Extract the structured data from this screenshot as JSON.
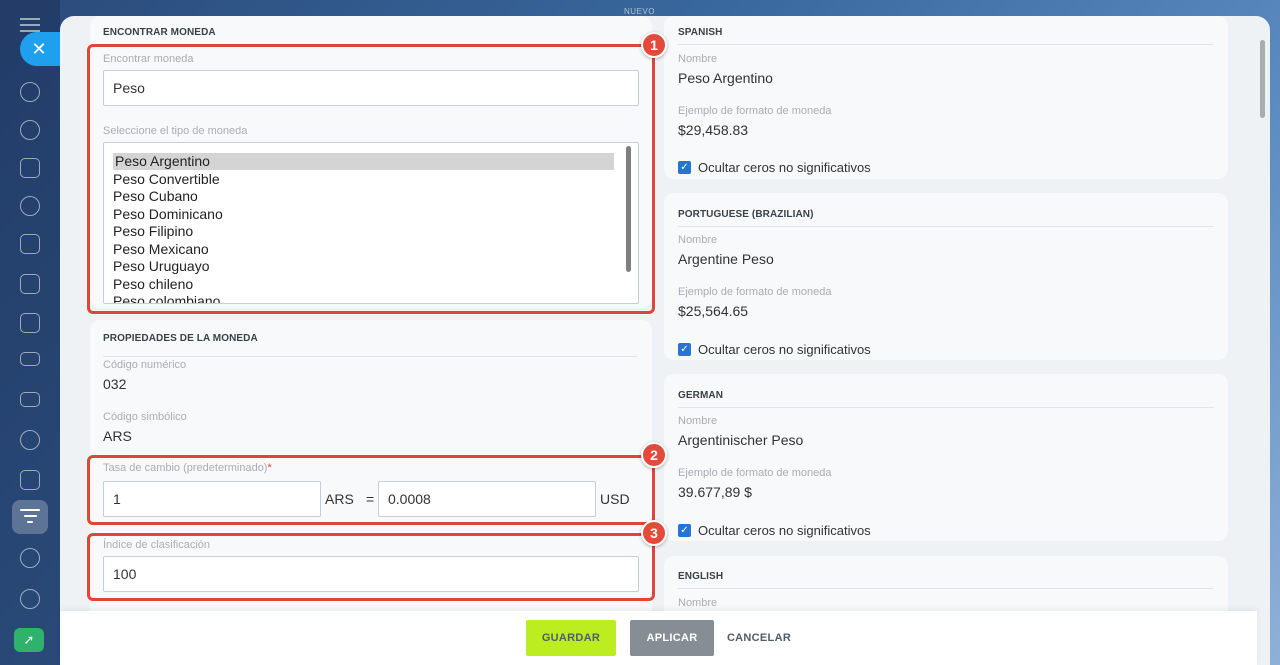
{
  "header": {
    "nuevo": "NUEVO"
  },
  "sidebar": {
    "close_symbol": "✕",
    "icons": [
      "menu-icon",
      "close-icon",
      "pulse-icon",
      "chat-icon",
      "tasks-icon",
      "crm-icon",
      "calendar-icon",
      "docs-icon",
      "whiteboard-icon",
      "billing-icon",
      "mail-icon",
      "contacts-icon",
      "checklist-icon",
      "filter-icon",
      "robot-icon",
      "settings-icon",
      "rocket-icon"
    ],
    "rocket_symbol": "➚"
  },
  "find": {
    "title": "ENCONTRAR MONEDA",
    "search_label": "Encontrar moneda",
    "search_value": "Peso",
    "type_label": "Seleccione el tipo de moneda",
    "options": [
      "Peso Argentino",
      "Peso Convertible",
      "Peso Cubano",
      "Peso Dominicano",
      "Peso Filipino",
      "Peso Mexicano",
      "Peso Uruguayo",
      "Peso chileno",
      "Peso colombiano"
    ],
    "selected": "Peso Argentino"
  },
  "props": {
    "title": "PROPIEDADES DE LA MONEDA",
    "numeric_label": "Código numérico",
    "numeric_value": "032",
    "symbolic_label": "Código simbólico",
    "symbolic_value": "ARS",
    "rate_label": "Tasa de cambio (predeterminado)",
    "rate_required": "*",
    "rate_amount": "1",
    "rate_from": "ARS",
    "rate_eq": "=",
    "rate_value": "0.0008",
    "rate_to": "USD",
    "sort_label": "Índice de clasificación",
    "sort_value": "100"
  },
  "badges": [
    "1",
    "2",
    "3"
  ],
  "languages": [
    {
      "title": "SPANISH",
      "name_label": "Nombre",
      "name": "Peso Argentino",
      "format_label": "Ejemplo de formato de moneda",
      "format": "$29,458.83",
      "hide_zeros": "Ocultar ceros no significativos"
    },
    {
      "title": "PORTUGUESE (BRAZILIAN)",
      "name_label": "Nombre",
      "name": "Argentine Peso",
      "format_label": "Ejemplo de formato de moneda",
      "format": "$25,564.65",
      "hide_zeros": "Ocultar ceros no significativos"
    },
    {
      "title": "GERMAN",
      "name_label": "Nombre",
      "name": "Argentinischer Peso",
      "format_label": "Ejemplo de formato de moneda",
      "format": "39.677,89 $",
      "hide_zeros": "Ocultar ceros no significativos"
    },
    {
      "title": "ENGLISH",
      "name_label": "Nombre"
    }
  ],
  "check_symbol": "✓",
  "footer": {
    "save": "GUARDAR",
    "apply": "APLICAR",
    "cancel": "CANCELAR"
  },
  "colors": {
    "accent": "#1fa0ee",
    "save": "#bbed21",
    "highlight": "#e0453a",
    "checkbox": "#2874d6"
  }
}
